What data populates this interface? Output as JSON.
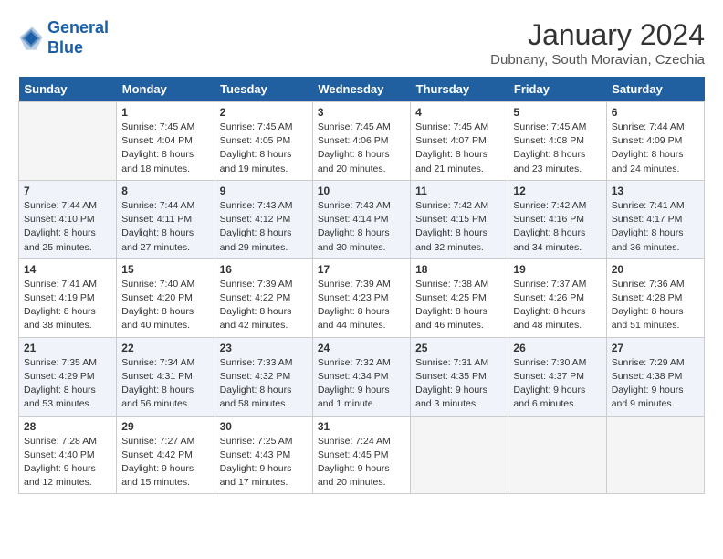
{
  "logo": {
    "line1": "General",
    "line2": "Blue"
  },
  "title": "January 2024",
  "subtitle": "Dubnany, South Moravian, Czechia",
  "weekdays": [
    "Sunday",
    "Monday",
    "Tuesday",
    "Wednesday",
    "Thursday",
    "Friday",
    "Saturday"
  ],
  "weeks": [
    [
      {
        "day": "",
        "info": ""
      },
      {
        "day": "1",
        "info": "Sunrise: 7:45 AM\nSunset: 4:04 PM\nDaylight: 8 hours\nand 18 minutes."
      },
      {
        "day": "2",
        "info": "Sunrise: 7:45 AM\nSunset: 4:05 PM\nDaylight: 8 hours\nand 19 minutes."
      },
      {
        "day": "3",
        "info": "Sunrise: 7:45 AM\nSunset: 4:06 PM\nDaylight: 8 hours\nand 20 minutes."
      },
      {
        "day": "4",
        "info": "Sunrise: 7:45 AM\nSunset: 4:07 PM\nDaylight: 8 hours\nand 21 minutes."
      },
      {
        "day": "5",
        "info": "Sunrise: 7:45 AM\nSunset: 4:08 PM\nDaylight: 8 hours\nand 23 minutes."
      },
      {
        "day": "6",
        "info": "Sunrise: 7:44 AM\nSunset: 4:09 PM\nDaylight: 8 hours\nand 24 minutes."
      }
    ],
    [
      {
        "day": "7",
        "info": "Sunrise: 7:44 AM\nSunset: 4:10 PM\nDaylight: 8 hours\nand 25 minutes."
      },
      {
        "day": "8",
        "info": "Sunrise: 7:44 AM\nSunset: 4:11 PM\nDaylight: 8 hours\nand 27 minutes."
      },
      {
        "day": "9",
        "info": "Sunrise: 7:43 AM\nSunset: 4:12 PM\nDaylight: 8 hours\nand 29 minutes."
      },
      {
        "day": "10",
        "info": "Sunrise: 7:43 AM\nSunset: 4:14 PM\nDaylight: 8 hours\nand 30 minutes."
      },
      {
        "day": "11",
        "info": "Sunrise: 7:42 AM\nSunset: 4:15 PM\nDaylight: 8 hours\nand 32 minutes."
      },
      {
        "day": "12",
        "info": "Sunrise: 7:42 AM\nSunset: 4:16 PM\nDaylight: 8 hours\nand 34 minutes."
      },
      {
        "day": "13",
        "info": "Sunrise: 7:41 AM\nSunset: 4:17 PM\nDaylight: 8 hours\nand 36 minutes."
      }
    ],
    [
      {
        "day": "14",
        "info": "Sunrise: 7:41 AM\nSunset: 4:19 PM\nDaylight: 8 hours\nand 38 minutes."
      },
      {
        "day": "15",
        "info": "Sunrise: 7:40 AM\nSunset: 4:20 PM\nDaylight: 8 hours\nand 40 minutes."
      },
      {
        "day": "16",
        "info": "Sunrise: 7:39 AM\nSunset: 4:22 PM\nDaylight: 8 hours\nand 42 minutes."
      },
      {
        "day": "17",
        "info": "Sunrise: 7:39 AM\nSunset: 4:23 PM\nDaylight: 8 hours\nand 44 minutes."
      },
      {
        "day": "18",
        "info": "Sunrise: 7:38 AM\nSunset: 4:25 PM\nDaylight: 8 hours\nand 46 minutes."
      },
      {
        "day": "19",
        "info": "Sunrise: 7:37 AM\nSunset: 4:26 PM\nDaylight: 8 hours\nand 48 minutes."
      },
      {
        "day": "20",
        "info": "Sunrise: 7:36 AM\nSunset: 4:28 PM\nDaylight: 8 hours\nand 51 minutes."
      }
    ],
    [
      {
        "day": "21",
        "info": "Sunrise: 7:35 AM\nSunset: 4:29 PM\nDaylight: 8 hours\nand 53 minutes."
      },
      {
        "day": "22",
        "info": "Sunrise: 7:34 AM\nSunset: 4:31 PM\nDaylight: 8 hours\nand 56 minutes."
      },
      {
        "day": "23",
        "info": "Sunrise: 7:33 AM\nSunset: 4:32 PM\nDaylight: 8 hours\nand 58 minutes."
      },
      {
        "day": "24",
        "info": "Sunrise: 7:32 AM\nSunset: 4:34 PM\nDaylight: 9 hours\nand 1 minute."
      },
      {
        "day": "25",
        "info": "Sunrise: 7:31 AM\nSunset: 4:35 PM\nDaylight: 9 hours\nand 3 minutes."
      },
      {
        "day": "26",
        "info": "Sunrise: 7:30 AM\nSunset: 4:37 PM\nDaylight: 9 hours\nand 6 minutes."
      },
      {
        "day": "27",
        "info": "Sunrise: 7:29 AM\nSunset: 4:38 PM\nDaylight: 9 hours\nand 9 minutes."
      }
    ],
    [
      {
        "day": "28",
        "info": "Sunrise: 7:28 AM\nSunset: 4:40 PM\nDaylight: 9 hours\nand 12 minutes."
      },
      {
        "day": "29",
        "info": "Sunrise: 7:27 AM\nSunset: 4:42 PM\nDaylight: 9 hours\nand 15 minutes."
      },
      {
        "day": "30",
        "info": "Sunrise: 7:25 AM\nSunset: 4:43 PM\nDaylight: 9 hours\nand 17 minutes."
      },
      {
        "day": "31",
        "info": "Sunrise: 7:24 AM\nSunset: 4:45 PM\nDaylight: 9 hours\nand 20 minutes."
      },
      {
        "day": "",
        "info": ""
      },
      {
        "day": "",
        "info": ""
      },
      {
        "day": "",
        "info": ""
      }
    ]
  ]
}
